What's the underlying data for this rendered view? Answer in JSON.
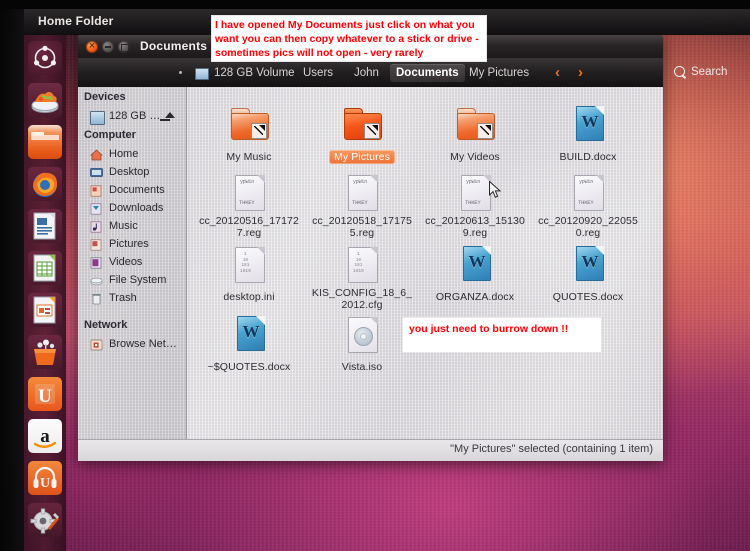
{
  "top_panel": {
    "title": "Home Folder"
  },
  "launcher": {
    "items": [
      {
        "name": "ubuntu-dash-icon",
        "label": "Dash Home"
      },
      {
        "name": "files-disk-icon",
        "label": "Files / Removable Drive"
      },
      {
        "name": "nautilus-folder-icon",
        "label": "Home Folder",
        "active": true
      },
      {
        "name": "firefox-icon",
        "label": "Firefox Web Browser"
      },
      {
        "name": "libreoffice-writer-icon",
        "label": "LibreOffice Writer"
      },
      {
        "name": "libreoffice-calc-icon",
        "label": "LibreOffice Calc"
      },
      {
        "name": "libreoffice-impress-icon",
        "label": "LibreOffice Impress"
      },
      {
        "name": "software-center-icon",
        "label": "Ubuntu Software Center"
      },
      {
        "name": "ubuntu-one-icon",
        "label": "Ubuntu One"
      },
      {
        "name": "amazon-icon",
        "label": "Amazon"
      },
      {
        "name": "ubuntu-one-music-icon",
        "label": "Ubuntu One Music"
      },
      {
        "name": "system-settings-icon",
        "label": "System Settings"
      }
    ]
  },
  "window": {
    "title": "Documents",
    "buttons": {
      "close": "Close",
      "minimize": "Minimize",
      "maximize": "Maximize"
    }
  },
  "pathbar": {
    "crumbs": [
      {
        "label": "128 GB Volume",
        "current": false
      },
      {
        "label": "Users",
        "current": false
      },
      {
        "label": "John",
        "current": false
      },
      {
        "label": "Documents",
        "current": true
      },
      {
        "label": "My Pictures",
        "current": false
      }
    ],
    "back_arrow": "‹",
    "forward_arrow": "›",
    "search_label": "Search"
  },
  "sidebar": {
    "sections": [
      {
        "heading": "Devices",
        "items": [
          {
            "label": "128 GB …",
            "icon": "drive-icon",
            "eject": true
          }
        ]
      },
      {
        "heading": "Computer",
        "items": [
          {
            "label": "Home",
            "icon": "home-icon"
          },
          {
            "label": "Desktop",
            "icon": "desktop-icon"
          },
          {
            "label": "Documents",
            "icon": "documents-icon"
          },
          {
            "label": "Downloads",
            "icon": "downloads-icon"
          },
          {
            "label": "Music",
            "icon": "music-icon"
          },
          {
            "label": "Pictures",
            "icon": "pictures-icon"
          },
          {
            "label": "Videos",
            "icon": "videos-icon"
          },
          {
            "label": "File System",
            "icon": "filesystem-icon"
          },
          {
            "label": "Trash",
            "icon": "trash-icon"
          }
        ]
      },
      {
        "heading": "Network",
        "items": [
          {
            "label": "Browse Net…",
            "icon": "network-icon"
          }
        ]
      }
    ]
  },
  "files": [
    {
      "name": "My Music",
      "icon": "folder-shortcut-icon",
      "selected": false
    },
    {
      "name": "My Pictures",
      "icon": "folder-shortcut-icon",
      "selected": true
    },
    {
      "name": "My Videos",
      "icon": "folder-shortcut-icon",
      "selected": false
    },
    {
      "name": "BUILD.docx",
      "icon": "word-document-icon",
      "selected": false
    },
    {
      "name": "cc_20120516_171727.reg",
      "icon": "registry-file-icon",
      "selected": false
    },
    {
      "name": "cc_20120518_171755.reg",
      "icon": "registry-file-icon",
      "selected": false
    },
    {
      "name": "cc_20120613_151309.reg",
      "icon": "registry-file-icon",
      "selected": false
    },
    {
      "name": "cc_20120920_220550.reg",
      "icon": "registry-file-icon",
      "selected": false
    },
    {
      "name": "desktop.ini",
      "icon": "ini-file-icon",
      "selected": false
    },
    {
      "name": "KIS_CONFIG_18_6_2012.cfg",
      "icon": "ini-file-icon",
      "selected": false
    },
    {
      "name": "ORGANZA.docx",
      "icon": "word-document-icon",
      "selected": false
    },
    {
      "name": "QUOTES.docx",
      "icon": "word-document-icon",
      "selected": false
    },
    {
      "name": "~$QUOTES.docx",
      "icon": "word-document-icon",
      "selected": false
    },
    {
      "name": "Vista.iso",
      "icon": "disc-image-icon",
      "selected": false
    }
  ],
  "statusbar": {
    "text": "\"My Pictures\" selected (containing 1 item)"
  },
  "annotations": {
    "note1": "I have opened My Documents just click on what you want you can then copy whatever to a stick or drive - sometimes pics will not open - very rarely",
    "note2": "you just need to burrow down !!"
  },
  "colors": {
    "annotation_text": "#ff0000",
    "selection": "#ef7035",
    "accent_orange": "#f07017",
    "panel_dark": "#1d1a1c"
  }
}
